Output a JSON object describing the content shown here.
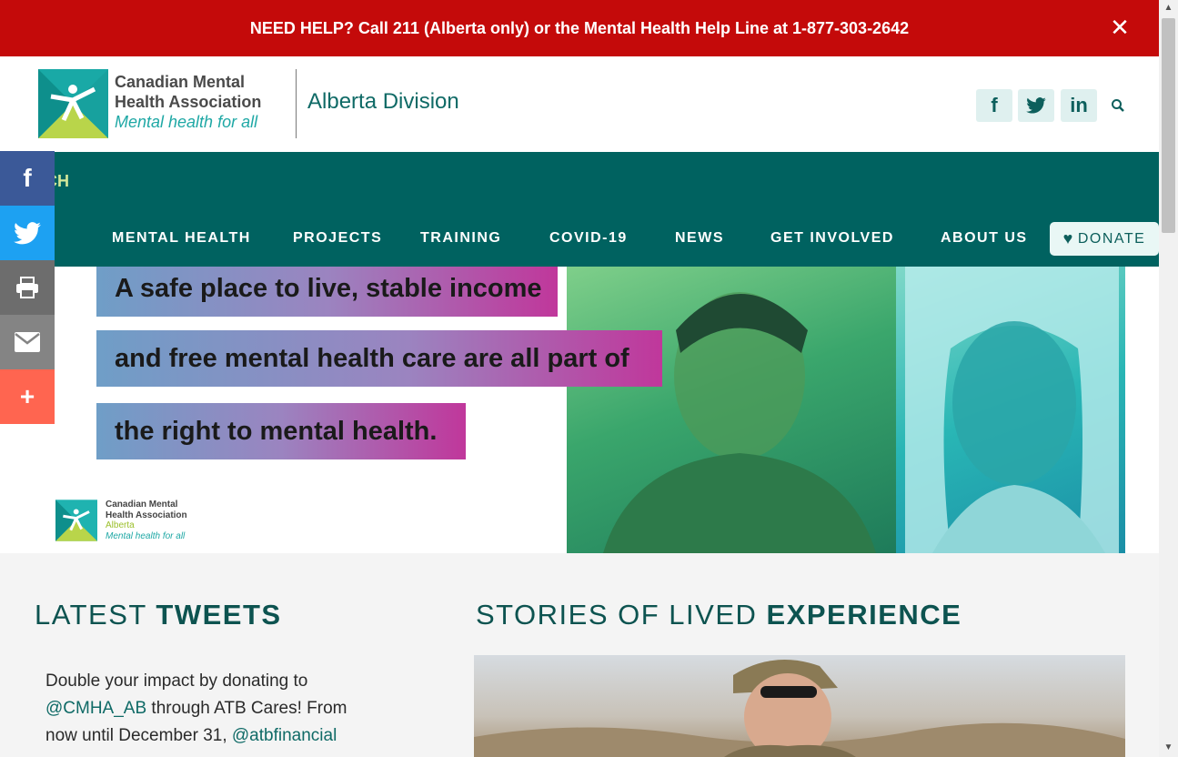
{
  "help_bar": {
    "text": "NEED HELP? Call 211 (Alberta only) or the Mental Health Help Line at 1-877-303-2642",
    "close_icon": "close-icon"
  },
  "header": {
    "logo": {
      "line1": "Canadian Mental",
      "line2": "Health Association",
      "tagline": "Mental health for all"
    },
    "division": "Alberta Division",
    "social": [
      {
        "label": "f",
        "icon": "facebook-icon"
      },
      {
        "label": "t",
        "icon": "twitter-icon"
      },
      {
        "label": "in",
        "icon": "linkedin-icon"
      }
    ],
    "search_icon": "search-icon"
  },
  "nav": {
    "search_label": "CH",
    "items": [
      "MENTAL HEALTH",
      "PROJECTS",
      "TRAINING",
      "COVID-19",
      "NEWS",
      "GET INVOLVED",
      "ABOUT US"
    ],
    "donate": "DONATE"
  },
  "share_bar": [
    {
      "icon": "facebook-icon",
      "color": "#3b5998"
    },
    {
      "icon": "twitter-icon",
      "color": "#1da1f2"
    },
    {
      "icon": "print-icon",
      "color": "#6d6d6d"
    },
    {
      "icon": "email-icon",
      "color": "#848484"
    },
    {
      "icon": "plus-icon",
      "color": "#ff6550"
    }
  ],
  "hero": {
    "lines": [
      "A safe place to live, stable income",
      "and free mental health care are all part of",
      "the right to mental health."
    ],
    "logo": {
      "line1": "Canadian Mental",
      "line2": "Health Association",
      "region": "Alberta",
      "tagline": "Mental health for all"
    }
  },
  "latest_tweets": {
    "title_light": "LATEST ",
    "title_bold": "TWEETS",
    "tweet": {
      "text1": "Double your impact by donating to",
      "mention1": "@CMHA_AB",
      "text2": " through ATB Cares! From now until December 31, ",
      "mention2": "@atbfinancial"
    }
  },
  "stories": {
    "title_light": "STORIES OF LIVED ",
    "title_bold": "EXPERIENCE"
  },
  "colors": {
    "help_bar": "#c40a0a",
    "nav": "#006260",
    "brand_teal": "#0f6a66"
  }
}
